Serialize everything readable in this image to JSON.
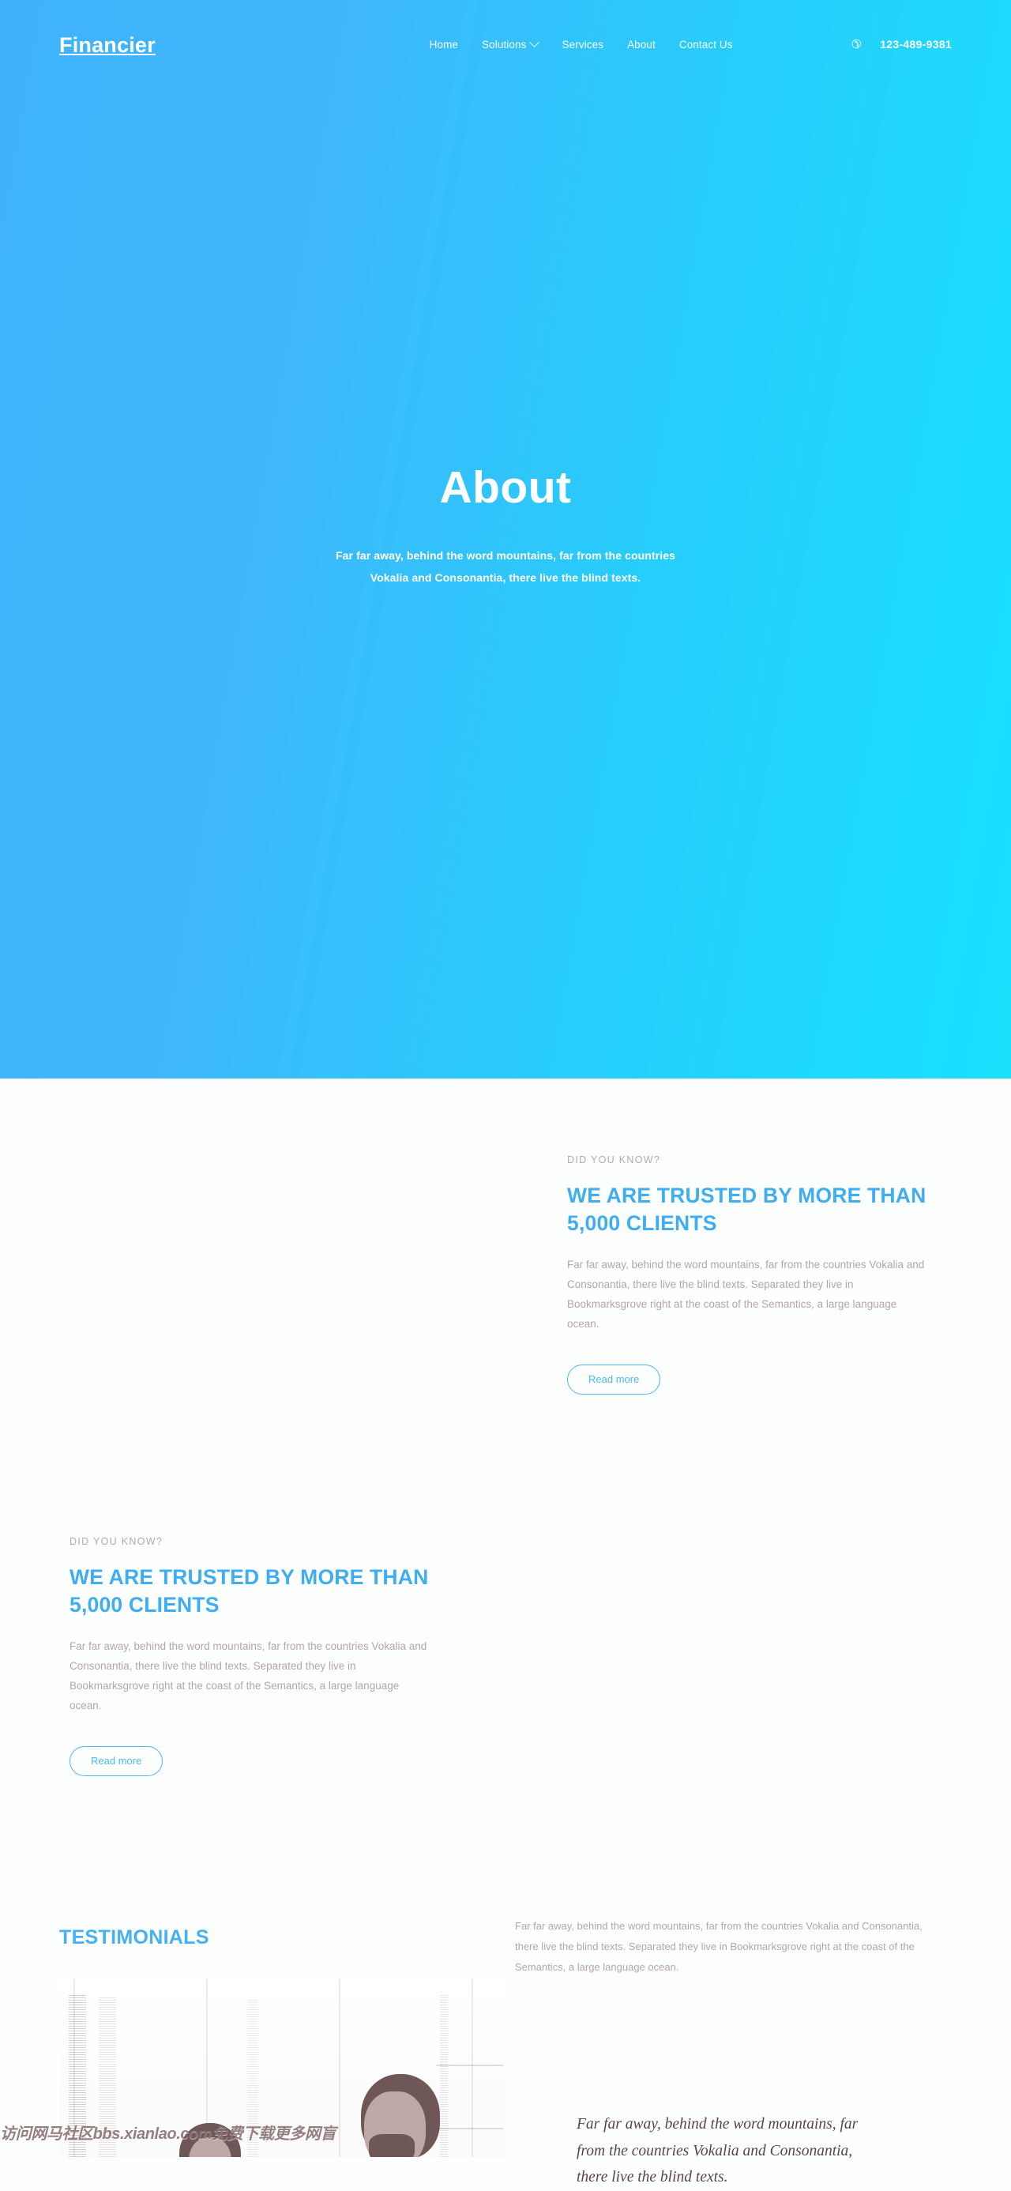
{
  "site": {
    "brand": "Financier",
    "accent_blue": "#3eadf2",
    "hero_gradient_from": "#3fb2fb",
    "hero_gradient_to": "#1ae0fe",
    "muted_text": "#b3a6a6"
  },
  "navbar": {
    "logo": "Financier",
    "links": [
      {
        "label": "Home",
        "icon": "",
        "active": false
      },
      {
        "label": "Solutions",
        "icon": "chevron-down-icon",
        "active": false
      },
      {
        "label": "Services",
        "icon": "",
        "active": false
      },
      {
        "label": "About",
        "icon": "",
        "active": true
      },
      {
        "label": "Contact Us",
        "icon": "",
        "active": false
      }
    ],
    "phone_icon": "phone-icon",
    "phone": "123-489-9381"
  },
  "hero": {
    "title": "About",
    "subtitle": "Far far away, behind the word mountains, far from the countries Vokalia and Consonantia, there live the blind texts."
  },
  "section_right": {
    "eyebrow": "DID YOU KNOW?",
    "headline": "WE ARE TRUSTED BY MORE THAN 5,000 CLIENTS",
    "body": "Far far away, behind the word mountains, far from the countries Vokalia and Consonantia, there live the blind texts. Separated they live in Bookmarksgrove right at the coast of the Semantics, a large language ocean.",
    "button": "Read more"
  },
  "section_left": {
    "eyebrow": "DID YOU KNOW?",
    "headline": "WE ARE TRUSTED BY MORE THAN 5,000 CLIENTS",
    "body": "Far far away, behind the word mountains, far from the countries Vokalia and Consonantia, there live the blind texts. Separated they live in Bookmarksgrove right at the coast of the Semantics, a large language ocean.",
    "button": "Read more"
  },
  "testimonials": {
    "heading": "TESTIMONIALS",
    "intro": "Far far away, behind the word mountains, far from the countries Vokalia and Consonantia, there live the blind texts. Separated they live in Bookmarksgrove right at the coast of the Semantics, a large language ocean.",
    "quote": "Far far away, behind the word mountains, far from the countries Vokalia and Consonantia, there live the blind texts.",
    "watermark": "访问网马社区bbs.xianlao.com免费下载更多网盲"
  }
}
